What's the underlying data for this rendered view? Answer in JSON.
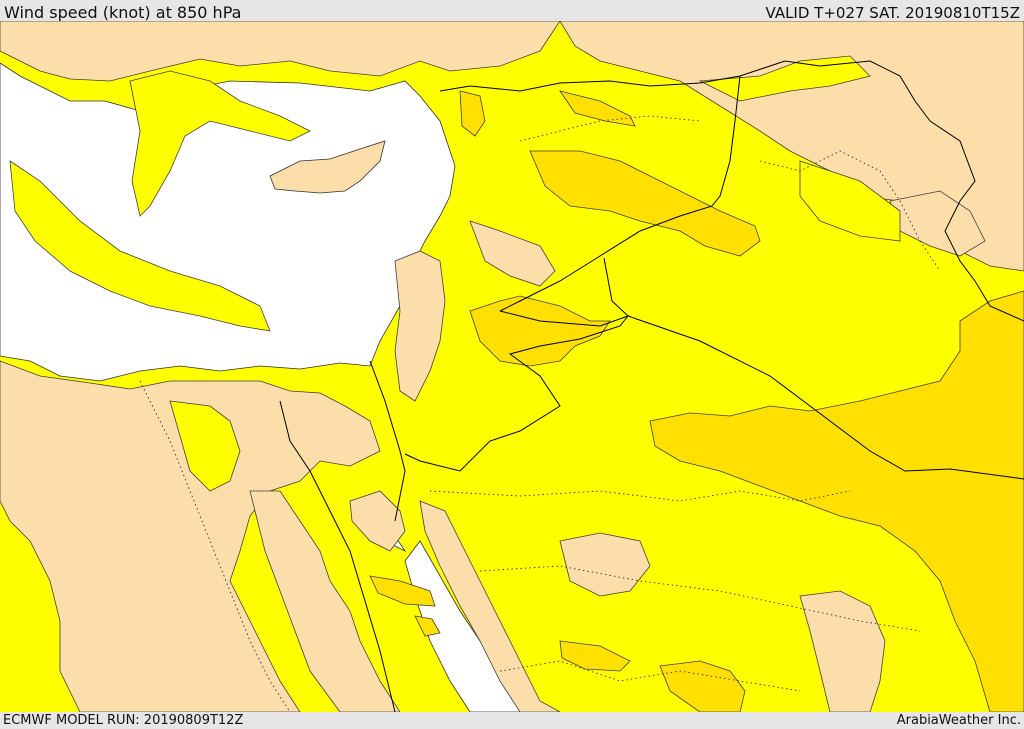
{
  "header": {
    "title": "Wind speed (knot) at 850 hPa",
    "valid": "VALID T+027 SAT. 20190810T15Z"
  },
  "footer": {
    "model_run": "ECMWF MODEL RUN: 20190809T12Z",
    "credit": "ArabiaWeather Inc."
  },
  "colors": {
    "sea": "#ffffff",
    "calm": "#fcdeaa",
    "light": "#ffff00",
    "moderate": "#ffe000",
    "contour": "#404040",
    "border": "#000000"
  }
}
